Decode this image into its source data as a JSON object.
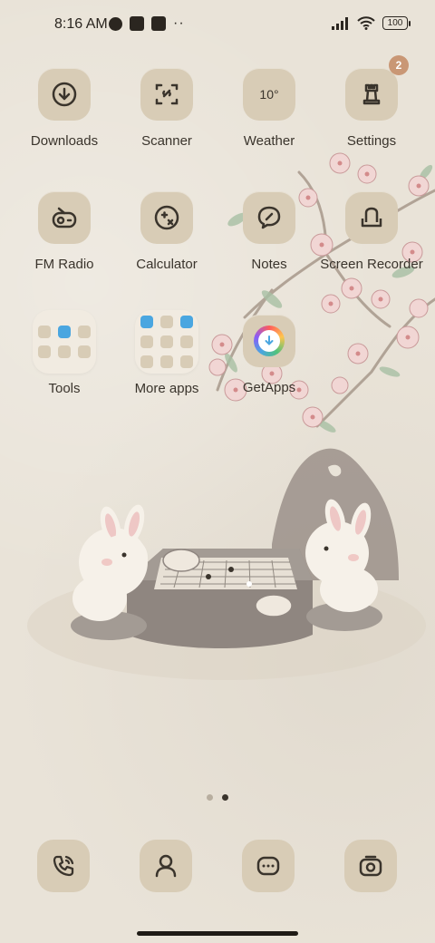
{
  "status_bar": {
    "time": "8:16 AM",
    "battery": "100"
  },
  "apps": [
    {
      "label": "Downloads",
      "icon": "download-icon"
    },
    {
      "label": "Scanner",
      "icon": "scanner-icon"
    },
    {
      "label": "Weather",
      "icon": "weather-icon",
      "icon_text": "10°"
    },
    {
      "label": "Settings",
      "icon": "settings-icon",
      "badge": "2"
    },
    {
      "label": "FM Radio",
      "icon": "radio-icon"
    },
    {
      "label": "Calculator",
      "icon": "calculator-icon"
    },
    {
      "label": "Notes",
      "icon": "notes-icon"
    },
    {
      "label": "Screen Recorder",
      "icon": "screen-recorder-icon"
    },
    {
      "label": "Tools",
      "icon": "folder-icon"
    },
    {
      "label": "More apps",
      "icon": "folder-icon"
    },
    {
      "label": "GetApps",
      "icon": "getapps-icon"
    }
  ],
  "dock": [
    {
      "name": "phone",
      "icon": "phone-icon"
    },
    {
      "name": "contacts",
      "icon": "contacts-icon"
    },
    {
      "name": "messages",
      "icon": "messages-icon"
    },
    {
      "name": "camera",
      "icon": "camera-icon"
    }
  ],
  "page_indicator": {
    "pages": 2,
    "current": 2
  },
  "colors": {
    "background": "#e9e3d8",
    "tile": "#d8ccb6",
    "badge": "#c99775",
    "text": "#3a342c"
  }
}
